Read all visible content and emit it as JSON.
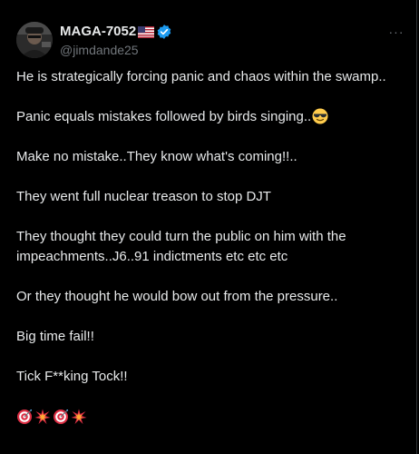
{
  "author": {
    "display_name": "MAGA-7052",
    "handle": "@jimdande25",
    "flag_icon": "us-flag-icon",
    "verified_icon": "verified-badge-icon",
    "accent_color": "#1d9bf0"
  },
  "menu": {
    "more_label": "···"
  },
  "post": {
    "lines": [
      "He is strategically forcing panic and chaos within the swamp..",
      "Panic equals mistakes followed by birds singing..",
      "Make no mistake..They know what's coming!!..",
      "They went full nuclear treason to stop DJT",
      "They thought they could turn the public on him with the impeachments..J6..91 indictments etc etc etc",
      "Or they thought he would bow out from the pressure..",
      "Big time fail!!",
      "Tick F**king Tock!!"
    ],
    "inline_emoji": "sunglasses-emoji",
    "footer_emojis": [
      "target-emoji",
      "explosion-emoji",
      "target-emoji",
      "explosion-emoji"
    ]
  },
  "colors": {
    "background": "#000000",
    "text": "#e7e9ea",
    "secondary": "#71767b"
  }
}
